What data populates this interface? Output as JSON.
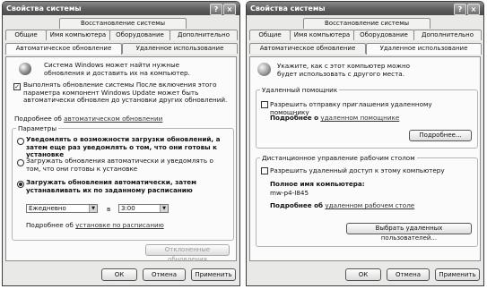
{
  "left": {
    "title": "Свойства системы",
    "tabs_top": {
      "restore": "Восстановление системы"
    },
    "tabs_mid": {
      "general": "Общие",
      "computer_name": "Имя компьютера",
      "hardware": "Оборудование",
      "advanced": "Дополнительно"
    },
    "tabs_bottom": {
      "auto_update": "Автоматическое обновление",
      "remote": "Удаленное использование"
    },
    "intro": "Система Windows может найти нужные обновления и доставить их на компьютер.",
    "keep_updated_label": "Выполнять обновление системы После включения этого параметра компонент Windows Update может быть автоматически обновлен до установки других обновлений.",
    "more_about_prefix": "Подробнее об",
    "more_about_link": "автоматическом обновлении",
    "params_legend": "Параметры",
    "option1": "Уведомлять о возможности загрузки обновлений, а затем еще раз уведомлять о том, что они готовы к установке",
    "option2": "Загружать обновления автоматически и уведомлять о том, что они готовы к установке",
    "option3": "Загружать обновления автоматически, затем устанавливать их по заданному расписанию",
    "schedule_day": "Ежедневно",
    "schedule_in": "в",
    "schedule_time": "3:00",
    "schedule_link_prefix": "Подробнее об",
    "schedule_link": "установке по расписанию",
    "declined_button": "Отклоненные обновления",
    "ok": "ОК",
    "cancel": "Отмена",
    "apply": "Применить"
  },
  "right": {
    "title": "Свойства системы",
    "tabs_top": {
      "restore": "Восстановление системы"
    },
    "tabs_mid": {
      "general": "Общие",
      "computer_name": "Имя компьютера",
      "hardware": "Оборудование",
      "advanced": "Дополнительно"
    },
    "tabs_bottom": {
      "auto_update": "Автоматическое обновление",
      "remote": "Удаленное использование"
    },
    "intro": "Укажите, как с этот компьютер можно будет использовать с другого места.",
    "assistance_legend": "Удаленный помощник",
    "assistance_checkbox": "Разрешить отправку приглашения удаленному помощнику",
    "assistance_more_prefix": "Подробнее о",
    "assistance_more_link": "удаленном помощнике",
    "advanced_button": "Подробнее...",
    "desktop_legend": "Дистанционное управление рабочим столом",
    "desktop_checkbox": "Разрешить удаленный доступ к этому компьютеру",
    "full_name_label": "Полное имя компьютера:",
    "full_name_value": "mw-p4-I845",
    "desktop_more_prefix": "Подробнее об",
    "desktop_more_link": "удаленном рабочем столе",
    "select_users_button": "Выбрать удаленных пользователей...",
    "ok": "ОК",
    "cancel": "Отмена",
    "apply": "Применить"
  },
  "titlebar_buttons": {
    "help": "?",
    "close": "×"
  },
  "check_mark": "✓",
  "dropdown_arrow": "▼",
  "icons": [
    "windows-shield-icon",
    "globe-remote-icon",
    "help-icon",
    "close-icon"
  ]
}
